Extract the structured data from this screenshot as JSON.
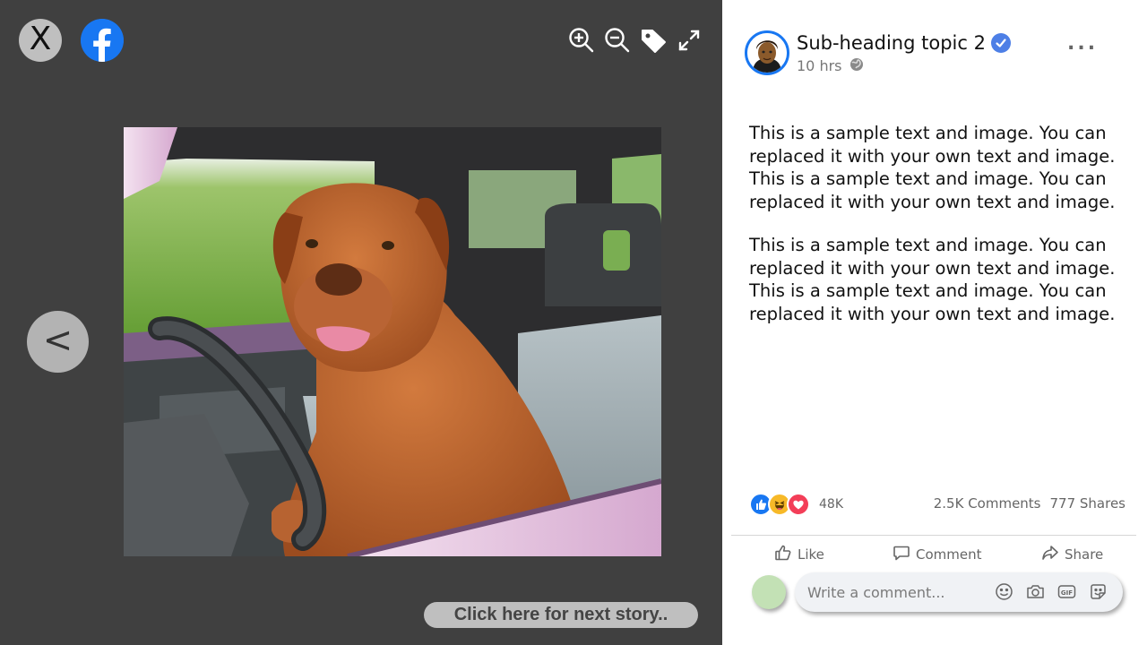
{
  "viewer": {
    "close_label": "X",
    "prev_label": "<",
    "next_story_label": "Click  here for next story..",
    "tools": [
      "zoom-in-icon",
      "zoom-out-icon",
      "tag-icon",
      "expand-icon"
    ]
  },
  "post": {
    "author": "Sub-heading topic 2",
    "time": "10 hrs",
    "more_label": "...",
    "paragraphs": [
      "This is a sample text and image. You can replaced it with your own text and image. This is a sample text and image. You can replaced it with your own text and image.",
      "This is a sample text and image. You can replaced it with your own text and image. This is a sample text and image. You can replaced it with your own text and image."
    ],
    "reaction_count": "48K",
    "comments": "2.5K Comments",
    "shares": "777 Shares"
  },
  "actions": {
    "like": "Like",
    "comment": "Comment",
    "share": "Share"
  },
  "comment_box": {
    "placeholder": "Write a comment..."
  },
  "colors": {
    "facebook_blue": "#1877f2",
    "viewer_bg": "#404040",
    "like_blue": "#1877f2",
    "love_red": "#f33e58",
    "haha_yellow": "#f7b928"
  }
}
